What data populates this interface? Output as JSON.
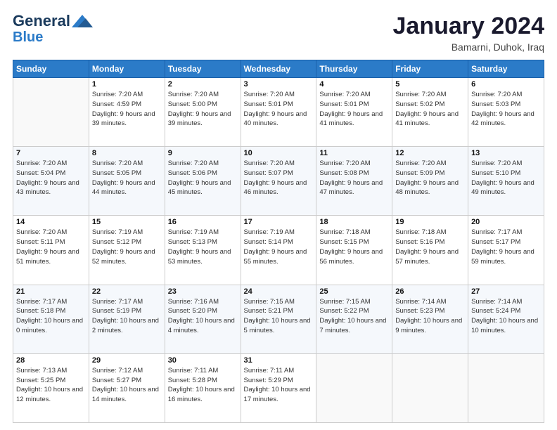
{
  "header": {
    "logo_general": "General",
    "logo_blue": "Blue",
    "month_title": "January 2024",
    "location": "Bamarni, Duhok, Iraq"
  },
  "weekdays": [
    "Sunday",
    "Monday",
    "Tuesday",
    "Wednesday",
    "Thursday",
    "Friday",
    "Saturday"
  ],
  "weeks": [
    [
      {
        "day": "",
        "sunrise": "",
        "sunset": "",
        "daylight": ""
      },
      {
        "day": "1",
        "sunrise": "Sunrise: 7:20 AM",
        "sunset": "Sunset: 4:59 PM",
        "daylight": "Daylight: 9 hours and 39 minutes."
      },
      {
        "day": "2",
        "sunrise": "Sunrise: 7:20 AM",
        "sunset": "Sunset: 5:00 PM",
        "daylight": "Daylight: 9 hours and 39 minutes."
      },
      {
        "day": "3",
        "sunrise": "Sunrise: 7:20 AM",
        "sunset": "Sunset: 5:01 PM",
        "daylight": "Daylight: 9 hours and 40 minutes."
      },
      {
        "day": "4",
        "sunrise": "Sunrise: 7:20 AM",
        "sunset": "Sunset: 5:01 PM",
        "daylight": "Daylight: 9 hours and 41 minutes."
      },
      {
        "day": "5",
        "sunrise": "Sunrise: 7:20 AM",
        "sunset": "Sunset: 5:02 PM",
        "daylight": "Daylight: 9 hours and 41 minutes."
      },
      {
        "day": "6",
        "sunrise": "Sunrise: 7:20 AM",
        "sunset": "Sunset: 5:03 PM",
        "daylight": "Daylight: 9 hours and 42 minutes."
      }
    ],
    [
      {
        "day": "7",
        "sunrise": "Sunrise: 7:20 AM",
        "sunset": "Sunset: 5:04 PM",
        "daylight": "Daylight: 9 hours and 43 minutes."
      },
      {
        "day": "8",
        "sunrise": "Sunrise: 7:20 AM",
        "sunset": "Sunset: 5:05 PM",
        "daylight": "Daylight: 9 hours and 44 minutes."
      },
      {
        "day": "9",
        "sunrise": "Sunrise: 7:20 AM",
        "sunset": "Sunset: 5:06 PM",
        "daylight": "Daylight: 9 hours and 45 minutes."
      },
      {
        "day": "10",
        "sunrise": "Sunrise: 7:20 AM",
        "sunset": "Sunset: 5:07 PM",
        "daylight": "Daylight: 9 hours and 46 minutes."
      },
      {
        "day": "11",
        "sunrise": "Sunrise: 7:20 AM",
        "sunset": "Sunset: 5:08 PM",
        "daylight": "Daylight: 9 hours and 47 minutes."
      },
      {
        "day": "12",
        "sunrise": "Sunrise: 7:20 AM",
        "sunset": "Sunset: 5:09 PM",
        "daylight": "Daylight: 9 hours and 48 minutes."
      },
      {
        "day": "13",
        "sunrise": "Sunrise: 7:20 AM",
        "sunset": "Sunset: 5:10 PM",
        "daylight": "Daylight: 9 hours and 49 minutes."
      }
    ],
    [
      {
        "day": "14",
        "sunrise": "Sunrise: 7:20 AM",
        "sunset": "Sunset: 5:11 PM",
        "daylight": "Daylight: 9 hours and 51 minutes."
      },
      {
        "day": "15",
        "sunrise": "Sunrise: 7:19 AM",
        "sunset": "Sunset: 5:12 PM",
        "daylight": "Daylight: 9 hours and 52 minutes."
      },
      {
        "day": "16",
        "sunrise": "Sunrise: 7:19 AM",
        "sunset": "Sunset: 5:13 PM",
        "daylight": "Daylight: 9 hours and 53 minutes."
      },
      {
        "day": "17",
        "sunrise": "Sunrise: 7:19 AM",
        "sunset": "Sunset: 5:14 PM",
        "daylight": "Daylight: 9 hours and 55 minutes."
      },
      {
        "day": "18",
        "sunrise": "Sunrise: 7:18 AM",
        "sunset": "Sunset: 5:15 PM",
        "daylight": "Daylight: 9 hours and 56 minutes."
      },
      {
        "day": "19",
        "sunrise": "Sunrise: 7:18 AM",
        "sunset": "Sunset: 5:16 PM",
        "daylight": "Daylight: 9 hours and 57 minutes."
      },
      {
        "day": "20",
        "sunrise": "Sunrise: 7:17 AM",
        "sunset": "Sunset: 5:17 PM",
        "daylight": "Daylight: 9 hours and 59 minutes."
      }
    ],
    [
      {
        "day": "21",
        "sunrise": "Sunrise: 7:17 AM",
        "sunset": "Sunset: 5:18 PM",
        "daylight": "Daylight: 10 hours and 0 minutes."
      },
      {
        "day": "22",
        "sunrise": "Sunrise: 7:17 AM",
        "sunset": "Sunset: 5:19 PM",
        "daylight": "Daylight: 10 hours and 2 minutes."
      },
      {
        "day": "23",
        "sunrise": "Sunrise: 7:16 AM",
        "sunset": "Sunset: 5:20 PM",
        "daylight": "Daylight: 10 hours and 4 minutes."
      },
      {
        "day": "24",
        "sunrise": "Sunrise: 7:15 AM",
        "sunset": "Sunset: 5:21 PM",
        "daylight": "Daylight: 10 hours and 5 minutes."
      },
      {
        "day": "25",
        "sunrise": "Sunrise: 7:15 AM",
        "sunset": "Sunset: 5:22 PM",
        "daylight": "Daylight: 10 hours and 7 minutes."
      },
      {
        "day": "26",
        "sunrise": "Sunrise: 7:14 AM",
        "sunset": "Sunset: 5:23 PM",
        "daylight": "Daylight: 10 hours and 9 minutes."
      },
      {
        "day": "27",
        "sunrise": "Sunrise: 7:14 AM",
        "sunset": "Sunset: 5:24 PM",
        "daylight": "Daylight: 10 hours and 10 minutes."
      }
    ],
    [
      {
        "day": "28",
        "sunrise": "Sunrise: 7:13 AM",
        "sunset": "Sunset: 5:25 PM",
        "daylight": "Daylight: 10 hours and 12 minutes."
      },
      {
        "day": "29",
        "sunrise": "Sunrise: 7:12 AM",
        "sunset": "Sunset: 5:27 PM",
        "daylight": "Daylight: 10 hours and 14 minutes."
      },
      {
        "day": "30",
        "sunrise": "Sunrise: 7:11 AM",
        "sunset": "Sunset: 5:28 PM",
        "daylight": "Daylight: 10 hours and 16 minutes."
      },
      {
        "day": "31",
        "sunrise": "Sunrise: 7:11 AM",
        "sunset": "Sunset: 5:29 PM",
        "daylight": "Daylight: 10 hours and 17 minutes."
      },
      {
        "day": "",
        "sunrise": "",
        "sunset": "",
        "daylight": ""
      },
      {
        "day": "",
        "sunrise": "",
        "sunset": "",
        "daylight": ""
      },
      {
        "day": "",
        "sunrise": "",
        "sunset": "",
        "daylight": ""
      }
    ]
  ]
}
